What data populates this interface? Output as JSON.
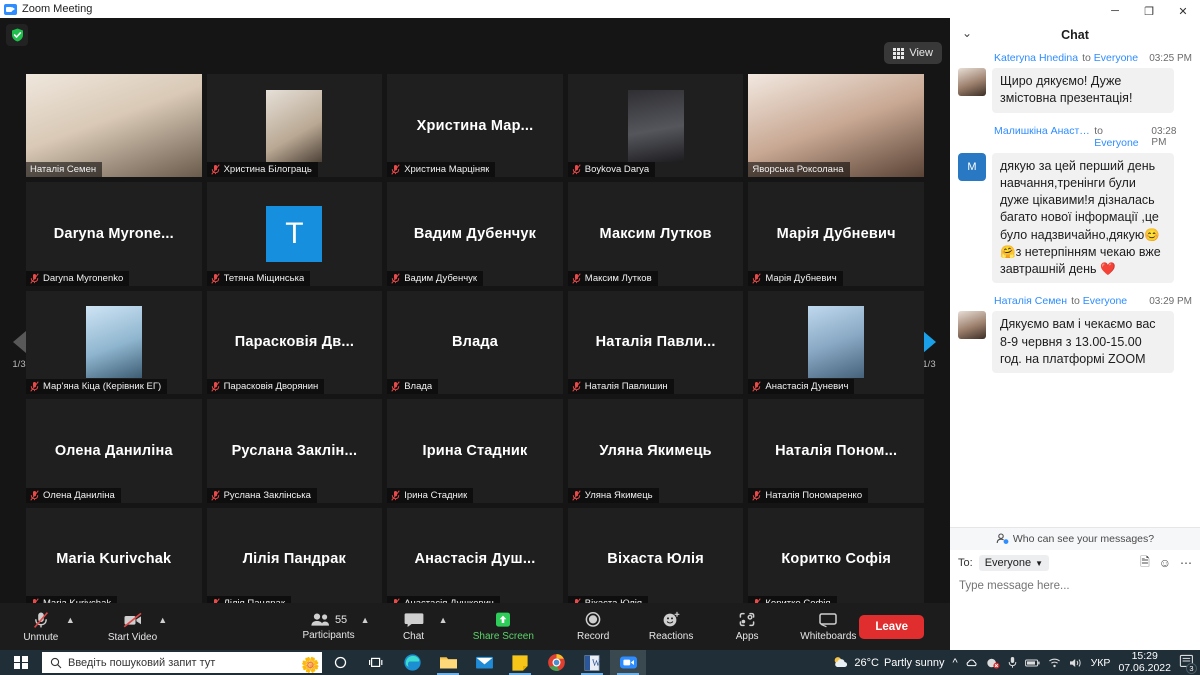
{
  "window": {
    "title": "Zoom Meeting",
    "minimize_label": "─",
    "maximize_label": "❐",
    "close_label": "✕"
  },
  "meeting": {
    "view_button_label": "View",
    "secure_icon": "shield-check-icon",
    "page_left_indicator": "1/3",
    "page_right_indicator": "1/3"
  },
  "participants_grid": [
    {
      "name": "Наталія Семен",
      "display": "video",
      "muted": false,
      "active": false
    },
    {
      "name": "Христина Білограць",
      "display": "photo",
      "muted": true,
      "active": false
    },
    {
      "name": "Христина Марціняк",
      "big_name": "Христина  Мар...",
      "display": "name",
      "muted": true,
      "active": false
    },
    {
      "name": "Boykova Darya",
      "display": "photo",
      "muted": true,
      "active": false
    },
    {
      "name": "Яворська Роксолана",
      "display": "video",
      "muted": false,
      "active": true
    },
    {
      "name": "Daryna Myronenko",
      "big_name": "Daryna  Myrone...",
      "display": "name",
      "muted": true,
      "active": false
    },
    {
      "name": "Тетяна Міщинська",
      "display": "letter",
      "letter": "Т",
      "muted": true,
      "active": false
    },
    {
      "name": "Вадим Дубенчук",
      "big_name": "Вадим Дубенчук",
      "display": "name",
      "muted": true,
      "active": false
    },
    {
      "name": "Максим Лутков",
      "big_name": "Максим Лутков",
      "display": "name",
      "muted": true,
      "active": false
    },
    {
      "name": "Марія Дубневич",
      "big_name": "Марія Дубневич",
      "display": "name",
      "muted": true,
      "active": false
    },
    {
      "name": "Мар'яна Кіца (Керівник ЕГ)",
      "display": "photo",
      "muted": true,
      "active": false
    },
    {
      "name": "Парасковія Дворянин",
      "big_name": "Парасковія Дв...",
      "display": "name",
      "muted": true,
      "active": false
    },
    {
      "name": "Влада",
      "big_name": "Влада",
      "display": "name",
      "muted": true,
      "active": false
    },
    {
      "name": "Наталія Павлишин",
      "big_name": "Наталія Павли...",
      "display": "name",
      "muted": true,
      "active": false
    },
    {
      "name": "Анастасія Дуневич",
      "display": "photo",
      "muted": true,
      "active": false
    },
    {
      "name": "Олена Даниліна",
      "big_name": "Олена Даниліна",
      "display": "name",
      "muted": true,
      "active": false
    },
    {
      "name": "Руслана Заклінська",
      "big_name": "Руслана  Заклін...",
      "display": "name",
      "muted": true,
      "active": false
    },
    {
      "name": "Ірина Стадник",
      "big_name": "Ірина Стадник",
      "display": "name",
      "muted": true,
      "active": false
    },
    {
      "name": "Уляна Якимець",
      "big_name": "Уляна Якимець",
      "display": "name",
      "muted": true,
      "active": false
    },
    {
      "name": "Наталія Пономаренко",
      "big_name": "Наталія Поном...",
      "display": "name",
      "muted": true,
      "active": false
    },
    {
      "name": "Maria Kurivchak",
      "big_name": "Maria Kurivchak",
      "display": "name",
      "muted": true,
      "active": false
    },
    {
      "name": "Лілія Пандрак",
      "big_name": "Лілія Пандрак",
      "display": "name",
      "muted": true,
      "active": false
    },
    {
      "name": "Анастасія Душкевич",
      "big_name": "Анастасія Душ...",
      "display": "name",
      "muted": true,
      "active": false
    },
    {
      "name": "Віхаста Юлія",
      "big_name": "Віхаста Юлія",
      "display": "name",
      "muted": true,
      "active": false
    },
    {
      "name": "Коритко Софія",
      "big_name": "Коритко Софія",
      "display": "name",
      "muted": true,
      "active": false
    }
  ],
  "toolbar": {
    "unmute_label": "Unmute",
    "start_video_label": "Start Video",
    "participants_label": "Participants",
    "participants_count": "55",
    "chat_label": "Chat",
    "share_screen_label": "Share Screen",
    "record_label": "Record",
    "reactions_label": "Reactions",
    "apps_label": "Apps",
    "whiteboards_label": "Whiteboards",
    "leave_label": "Leave",
    "share_screen_color": "#5ad469",
    "leave_color": "#e02e2e"
  },
  "chat": {
    "panel_title": "Chat",
    "to_word": "to",
    "messages": [
      {
        "from": "Kateryna Hnedina",
        "to": "Everyone",
        "time": "03:25 PM",
        "text": "Щиро дякуємо! Дуже змістовна презентація!",
        "avatar_type": "photo"
      },
      {
        "from": "Малишкіна Анаста…",
        "to": "Everyone",
        "time": "03:28 PM",
        "text": "дякую за цей перший день навчання,тренінги були дуже цікавими!я дізналась багато нової інформації ,це було надзвичайно,дякую😊🤗з нетерпінням чекаю вже завтрашній день ❤️",
        "avatar_type": "letter",
        "avatar_letter": "М"
      },
      {
        "from": "Наталія Семен",
        "to": "Everyone",
        "time": "03:29 PM",
        "text": "Дякуємо вам і чекаємо вас 8-9 червня з 13.00-15.00 год. на платформі ZOOM",
        "avatar_type": "photo"
      }
    ],
    "who_can_see_label": "Who can see your messages?",
    "to_label": "To:",
    "to_value": "Everyone",
    "input_placeholder": "Type message here..."
  },
  "taskbar": {
    "search_placeholder": "Введіть пошуковий запит тут",
    "weather_temp": "26°C",
    "weather_desc": "Partly sunny",
    "language": "УКР",
    "time": "15:29",
    "date": "07.06.2022",
    "notification_count": "3"
  }
}
